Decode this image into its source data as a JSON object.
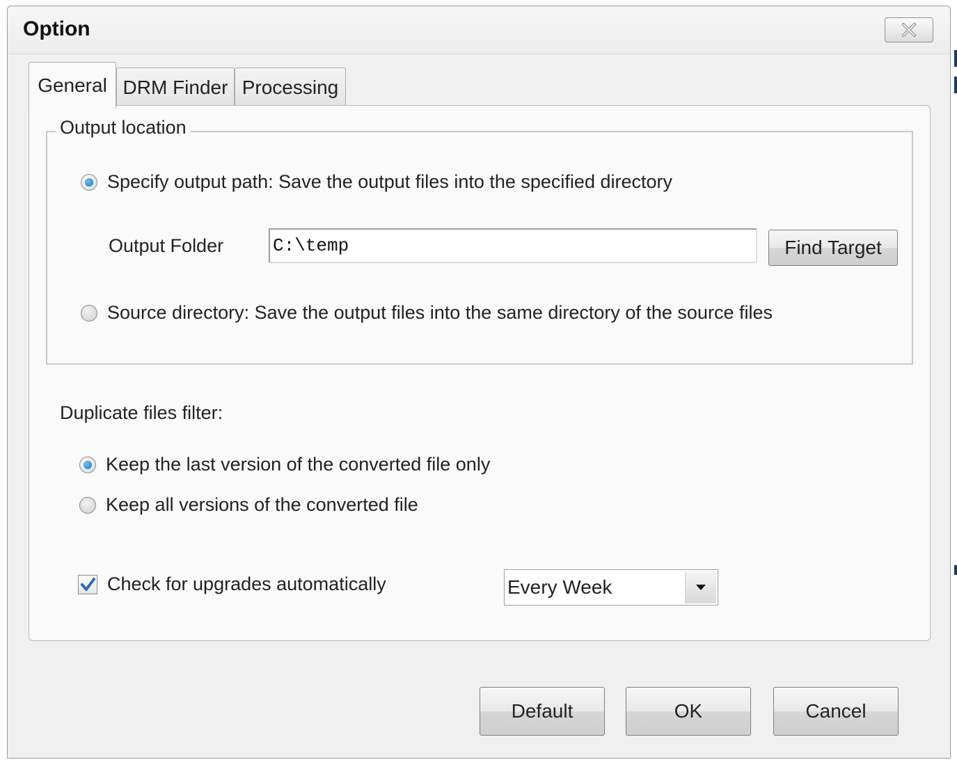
{
  "dialog": {
    "title": "Option",
    "tabs": [
      {
        "label": "General",
        "active": true
      },
      {
        "label": "DRM Finder",
        "active": false
      },
      {
        "label": "Processing",
        "active": false
      }
    ]
  },
  "general": {
    "output_location": {
      "legend": "Output location",
      "specify_path_label": "Specify output path: Save the output files into the specified directory",
      "specify_path_selected": true,
      "output_folder_label": "Output Folder",
      "output_folder_value": "C:\\temp",
      "find_target_label": "Find Target",
      "source_directory_label": "Source directory: Save the output files into the same directory of the source files",
      "source_directory_selected": false
    },
    "duplicate_filter": {
      "heading": "Duplicate files filter:",
      "keep_last_label": "Keep the last version of the converted file only",
      "keep_last_selected": true,
      "keep_all_label": "Keep all versions of the converted file",
      "keep_all_selected": false
    },
    "upgrades": {
      "label": "Check for upgrades automatically",
      "checked": true,
      "frequency": "Every Week"
    }
  },
  "buttons": {
    "default_label": "Default",
    "ok_label": "OK",
    "cancel_label": "Cancel"
  },
  "icons": {
    "close": "close-icon",
    "dropdown": "chevron-down-icon",
    "check": "checkmark-icon"
  },
  "colors": {
    "radio_selected": "#1b6fb3",
    "check_mark": "#2a6fb0"
  }
}
